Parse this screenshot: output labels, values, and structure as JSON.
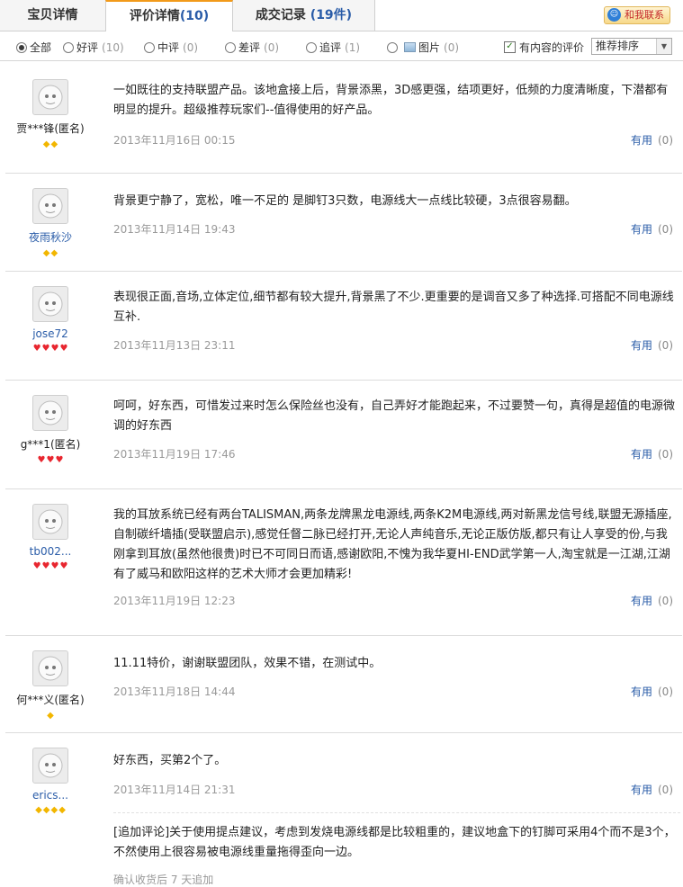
{
  "tabs": [
    {
      "label": "宝贝详情",
      "count": ""
    },
    {
      "label": "评价详情",
      "count": "(10)"
    },
    {
      "label": "成交记录",
      "count": "(19件)"
    }
  ],
  "contact": {
    "label": "和我联系"
  },
  "filters": {
    "all": "全部",
    "good": {
      "label": "好评",
      "count": "(10)"
    },
    "medium": {
      "label": "中评",
      "count": "(0)"
    },
    "bad": {
      "label": "差评",
      "count": "(0)"
    },
    "followup": {
      "label": "追评",
      "count": "(1)"
    },
    "image": {
      "label": "图片",
      "count": "(0)"
    },
    "has_content": "有内容的评价",
    "sort": "推荐排序"
  },
  "colors": {
    "link": "#2a5ca8",
    "date": "#999999",
    "tab_accent": "#f29a1a",
    "heart": "#e8262f",
    "diamond": "#f2b600"
  },
  "reviews": [
    {
      "user": "贾***锋(匿名)",
      "badge_icons": [
        "diamond",
        "diamond"
      ],
      "text": "一如既往的支持联盟产品。该地盒接上后，背景添黑，3D感更强，结项更好，低频的力度清晰度，下潜都有明显的提升。超级推荐玩家们--值得使用的好产品。",
      "date": "2013年11月16日 00:15",
      "useful": "有用",
      "useful_count": "(0)"
    },
    {
      "user": "夜雨秋沙",
      "badge_icons": [
        "diamond",
        "diamond"
      ],
      "text": "背景更宁静了，宽松，唯一不足的 是脚钉3只数，电源线大一点线比较硬，3点很容易翻。",
      "date": "2013年11月14日 19:43",
      "useful": "有用",
      "useful_count": "(0)"
    },
    {
      "user": "jose72",
      "badge_icons": [
        "heart",
        "heart",
        "heart",
        "heart"
      ],
      "text": "表现很正面,音场,立体定位,细节都有较大提升,背景黑了不少.更重要的是调音又多了种选择.可搭配不同电源线互补.",
      "date": "2013年11月13日 23:11",
      "useful": "有用",
      "useful_count": "(0)"
    },
    {
      "user": "g***1(匿名)",
      "badge_icons": [
        "heart",
        "heart",
        "heart"
      ],
      "text": "呵呵，好东西，可惜发过来时怎么保险丝也没有，自己弄好才能跑起来，不过要赞一句，真得是超值的电源微调的好东西",
      "date": "2013年11月19日 17:46",
      "useful": "有用",
      "useful_count": "(0)"
    },
    {
      "user": "tb002...",
      "badge_icons": [
        "heart",
        "heart",
        "heart",
        "heart"
      ],
      "text": "我的耳放系统已经有两台TALISMAN,两条龙牌黑龙电源线,两条K2M电源线,两对新黑龙信号线,联盟无源插座,自制碳纤墙插(受联盟启示),感觉任督二脉已经打开,无论人声纯音乐,无论正版仿版,都只有让人享受的份,与我刚拿到耳放(虽然他很贵)时已不可同日而语,感谢欧阳,不愧为我华夏HI-END武学第一人,淘宝就是一江湖,江湖有了威马和欧阳这样的艺术大师才会更加精彩!",
      "date": "2013年11月19日 12:23",
      "useful": "有用",
      "useful_count": "(0)"
    },
    {
      "user": "何***义(匿名)",
      "badge_icons": [
        "diamond"
      ],
      "text": "11.11特价，谢谢联盟团队，效果不错，在测试中。",
      "date": "2013年11月18日 14:44",
      "useful": "有用",
      "useful_count": "(0)"
    },
    {
      "user": "erics...",
      "badge_icons": [
        "diamond",
        "diamond",
        "diamond",
        "diamond"
      ],
      "text": "好东西，买第2个了。",
      "date": "2013年11月14日 21:31",
      "useful": "有用",
      "useful_count": "(0)",
      "followup": "[追加评论]关于使用提点建议，考虑到发烧电源线都是比较粗重的，建议地盒下的钉脚可采用4个而不是3个，不然使用上很容易被电源线重量拖得歪向一边。",
      "followup_note": "确认收货后 7 天追加"
    }
  ]
}
